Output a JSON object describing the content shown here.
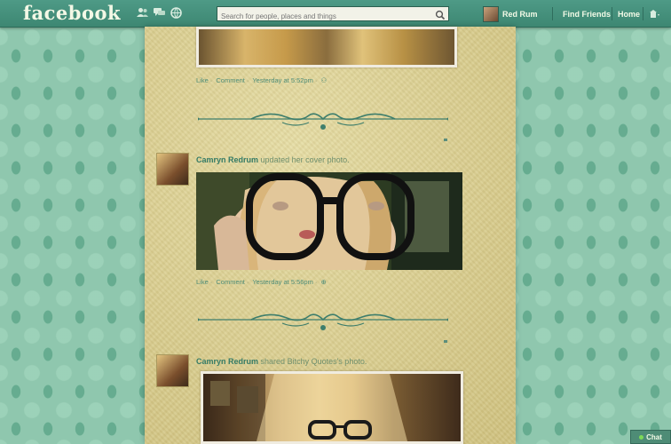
{
  "topbar": {
    "logo": "facebook",
    "search_placeholder": "Search for people, places and things",
    "profile_name": "Red Rum",
    "nav_find_friends": "Find Friends",
    "nav_home": "Home",
    "icons": [
      "friend-requests-icon",
      "messages-icon",
      "notifications-icon",
      "search-icon",
      "settings-icon"
    ]
  },
  "posts": [
    {
      "meta": {
        "like": "Like",
        "comment": "Comment",
        "time": "Yesterday at 5:52pm"
      }
    },
    {
      "author": "Camryn Redrum",
      "action": "updated her cover photo.",
      "meta": {
        "like": "Like",
        "comment": "Comment",
        "time": "Yesterday at 5:56pm"
      }
    },
    {
      "author": "Camryn Redrum",
      "action": "shared Bitchy Quotes's photo."
    }
  ],
  "chat": {
    "label": "Chat"
  },
  "colors": {
    "topbar": "#3d8772",
    "link": "#347b66",
    "paper": "#d9cf94",
    "background": "#8fc7ae"
  }
}
